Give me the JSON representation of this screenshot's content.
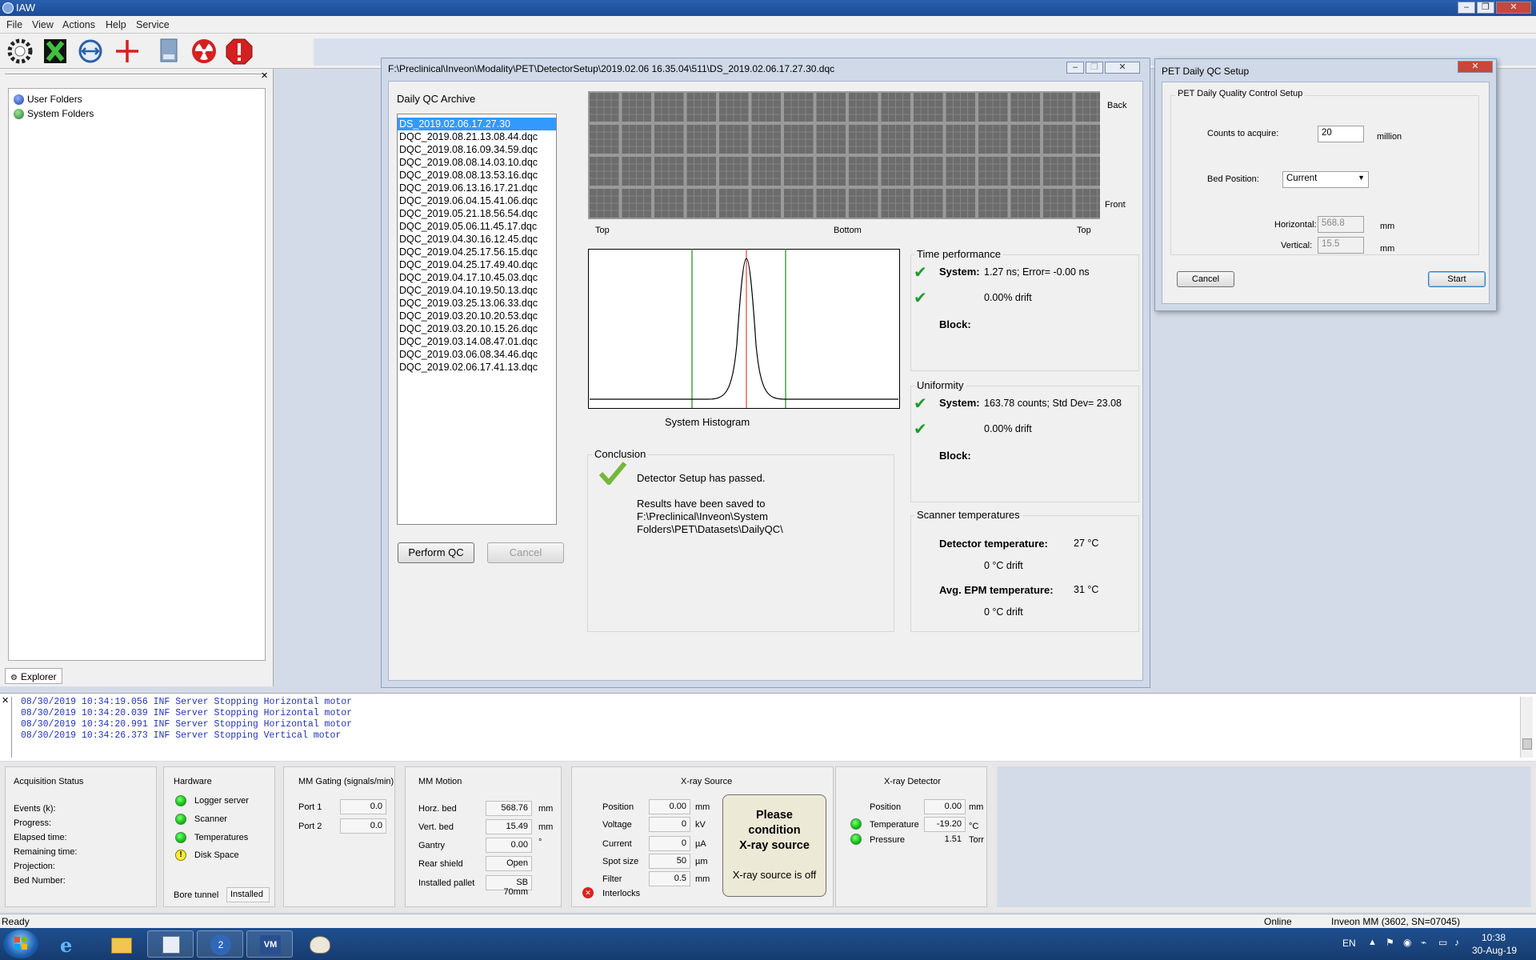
{
  "app": {
    "title": "IAW"
  },
  "menu": {
    "file": "File",
    "view": "View",
    "actions": "Actions",
    "help": "Help",
    "service": "Service"
  },
  "explorer": {
    "items": [
      "User Folders",
      "System Folders"
    ],
    "tab": "Explorer"
  },
  "ds_window": {
    "title": "F:\\Preclinical\\Inveon\\Modality\\PET\\DetectorSetup\\2019.02.06 16.35.04\\511\\DS_2019.02.06.17.27.30.dqc",
    "archive_label": "Daily QC Archive",
    "archive_items": [
      "DS_2019.02.06.17.27.30",
      "DQC_2019.08.21.13.08.44.dqc",
      "DQC_2019.08.16.09.34.59.dqc",
      "DQC_2019.08.08.14.03.10.dqc",
      "DQC_2019.08.08.13.53.16.dqc",
      "DQC_2019.06.13.16.17.21.dqc",
      "DQC_2019.06.04.15.41.06.dqc",
      "DQC_2019.05.21.18.56.54.dqc",
      "DQC_2019.05.06.11.45.17.dqc",
      "DQC_2019.04.30.16.12.45.dqc",
      "DQC_2019.04.25.17.56.15.dqc",
      "DQC_2019.04.25.17.49.40.dqc",
      "DQC_2019.04.17.10.45.03.dqc",
      "DQC_2019.04.10.19.50.13.dqc",
      "DQC_2019.03.25.13.06.33.dqc",
      "DQC_2019.03.20.10.20.53.dqc",
      "DQC_2019.03.20.10.15.26.dqc",
      "DQC_2019.03.14.08.47.01.dqc",
      "DQC_2019.03.06.08.34.46.dqc",
      "DQC_2019.02.06.17.41.13.dqc"
    ],
    "perform_qc": "Perform QC",
    "cancel": "Cancel",
    "map_labels": {
      "back": "Back",
      "front": "Front",
      "top_left": "Top",
      "bottom": "Bottom",
      "top_right": "Top"
    },
    "histogram_label": "System Histogram",
    "time_perf": {
      "title": "Time performance",
      "system_label": "System:",
      "system_value": "1.27 ns;   Error= -0.00 ns",
      "drift": "0.00% drift",
      "block": "Block:"
    },
    "uniformity": {
      "title": "Uniformity",
      "system_label": "System:",
      "system_value": "163.78 counts;   Std Dev=  23.08",
      "drift": "0.00% drift",
      "block": "Block:"
    },
    "temps": {
      "title": "Scanner temperatures",
      "detector_label": "Detector temperature:",
      "detector_value": "27 °C",
      "detector_drift": "0 °C drift",
      "epm_label": "Avg. EPM temperature:",
      "epm_value": "31 °C",
      "epm_drift": "0 °C drift"
    },
    "conclusion": {
      "title": "Conclusion",
      "passed": "Detector Setup has passed.",
      "saved_line1": "Results have been saved to",
      "saved_line2": "F:\\Preclinical\\Inveon\\System",
      "saved_line3": "Folders\\PET\\Datasets\\DailyQC\\"
    }
  },
  "pet_dialog": {
    "title": "PET Daily QC Setup",
    "group": "PET Daily Quality Control Setup",
    "counts_label": "Counts to acquire:",
    "counts_value": "20",
    "counts_unit": "million",
    "bed_label": "Bed Position:",
    "bed_value": "Current",
    "horizontal_label": "Horizontal:",
    "horizontal_value": "568.8",
    "vertical_label": "Vertical:",
    "vertical_value": "15.5",
    "unit_mm": "mm",
    "cancel": "Cancel",
    "start": "Start"
  },
  "log": [
    "08/30/2019 10:34:19.056 INF Server Stopping Horizontal motor",
    "08/30/2019 10:34:20.039 INF Server Stopping Horizontal motor",
    "08/30/2019 10:34:20.991 INF Server Stopping Horizontal motor",
    "08/30/2019 10:34:26.373 INF Server Stopping Vertical motor"
  ],
  "acq": {
    "title": "Acquisition Status",
    "events": "Events (k):",
    "progress": "Progress:",
    "elapsed": "Elapsed time:",
    "remaining": "Remaining time:",
    "projection": "Projection:",
    "bed_number": "Bed Number:"
  },
  "hardware": {
    "title": "Hardware",
    "logger": "Logger server",
    "scanner": "Scanner",
    "temperatures": "Temperatures",
    "disk": "Disk Space",
    "bore_label": "Bore tunnel",
    "bore_value": "Installed"
  },
  "gating": {
    "title": "MM Gating (signals/min)",
    "port1": "Port 1",
    "port1_value": "0.0",
    "port2": "Port 2",
    "port2_value": "0.0"
  },
  "motion": {
    "title": "MM Motion",
    "horz": "Horz. bed",
    "horz_value": "568.76",
    "horz_unit": "mm",
    "vert": "Vert. bed",
    "vert_value": "15.49",
    "vert_unit": "mm",
    "gantry": "Gantry",
    "gantry_value": "0.00",
    "gantry_unit": "°",
    "rear": "Rear shield",
    "rear_value": "Open",
    "pallet": "Installed pallet",
    "pallet_value": "SB 70mm"
  },
  "xray_source": {
    "title": "X-ray Source",
    "position": "Position",
    "position_value": "0.00",
    "position_unit": "mm",
    "voltage": "Voltage",
    "voltage_value": "0",
    "voltage_unit": "kV",
    "current": "Current",
    "current_value": "0",
    "current_unit": "µA",
    "spot": "Spot size",
    "spot_value": "50",
    "spot_unit": "µm",
    "filter": "Filter",
    "filter_value": "0.5",
    "filter_unit": "mm",
    "interlocks": "Interlocks",
    "notice_line1": "Please",
    "notice_line2": "condition",
    "notice_line3": "X-ray source",
    "notice_state": "X-ray source is off"
  },
  "xray_detector": {
    "title": "X-ray Detector",
    "position": "Position",
    "position_value": "0.00",
    "position_unit": "mm",
    "temperature": "Temperature",
    "temperature_value": "-19.20",
    "temperature_unit": "°C",
    "pressure": "Pressure",
    "pressure_value": "1.51",
    "pressure_unit": "Torr"
  },
  "statusbar": {
    "ready": "Ready",
    "online": "Online",
    "device": "Inveon MM (3602, SN=07045)"
  },
  "taskbar": {
    "lang": "EN",
    "time": "10:38",
    "date": "30-Aug-19"
  }
}
